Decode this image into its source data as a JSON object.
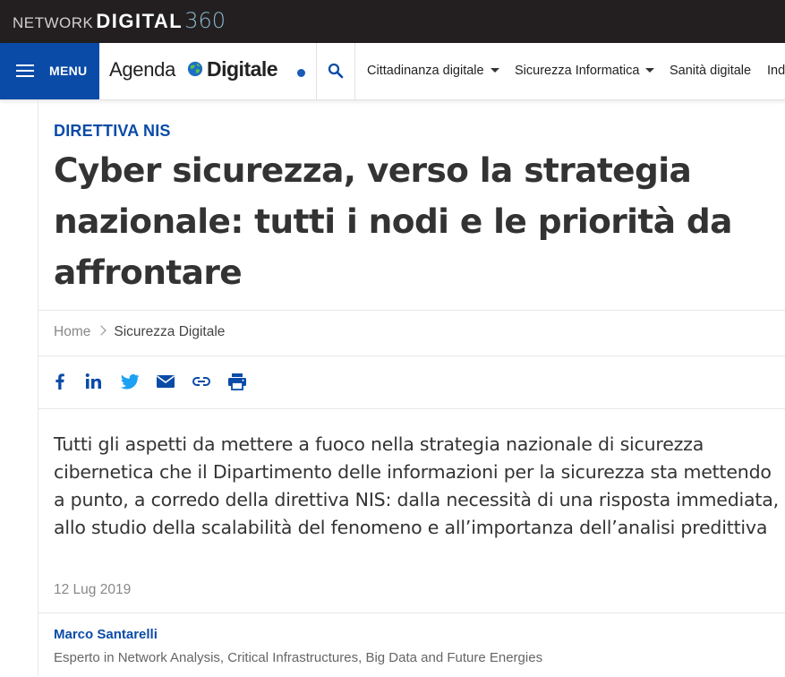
{
  "network_bar": {
    "logo_network": "NETWORK",
    "logo_digital": "DIGITAL",
    "logo_360": "360"
  },
  "header": {
    "menu_label": "MENU",
    "brand_agenda": "Agenda",
    "brand_digitale": "Digitale",
    "nav_items": [
      {
        "label": "Cittadinanza digitale",
        "has_dropdown": true
      },
      {
        "label": "Sicurezza Informatica",
        "has_dropdown": true
      },
      {
        "label": "Sanità digitale",
        "has_dropdown": false
      },
      {
        "label": "Ind",
        "has_dropdown": false
      }
    ]
  },
  "article": {
    "kicker": "DIRETTIVA NIS",
    "title": "Cyber sicurezza, verso la strategia nazionale: tutti i nodi e le priorità da affrontare",
    "breadcrumb": {
      "home": "Home",
      "current": "Sicurezza Digitale"
    },
    "share_icons": [
      "facebook-icon",
      "linkedin-icon",
      "twitter-icon",
      "email-icon",
      "link-icon",
      "print-icon"
    ],
    "summary": "Tutti gli aspetti da mettere a fuoco nella strategia nazionale di sicurezza cibernetica che il Dipartimento delle informazioni per la sicurezza sta mettendo a punto, a corredo della direttiva NIS: dalla necessità di una risposta immediata, allo studio della scalabilità del fenomeno e all’importanza dell’analisi predittiva",
    "date": "12 Lug 2019",
    "author": {
      "name": "Marco Santarelli",
      "role": "Esperto in Network Analysis, Critical Infrastructures, Big Data and Future Energies"
    }
  },
  "colors": {
    "brand_blue": "#0a4ba8",
    "network_bar": "#231f20",
    "twitter_blue": "#1da1f2",
    "title_text": "#333333"
  }
}
